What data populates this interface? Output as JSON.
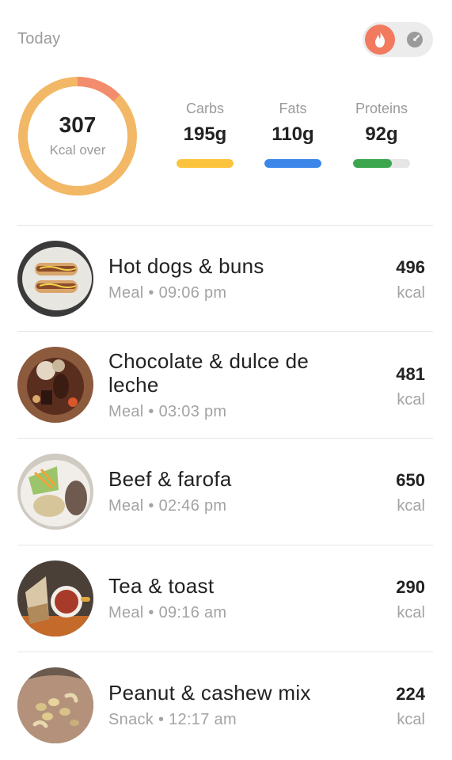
{
  "header": {
    "title": "Today"
  },
  "toggle": {
    "active": "flame-icon",
    "inactive": "gauge-icon",
    "accent": "#f27a5f"
  },
  "summary": {
    "value": "307",
    "label": "Kcal over",
    "ring_color": "#f2b866",
    "over_color": "#f28c6c"
  },
  "macros": [
    {
      "label": "Carbs",
      "value": "195g",
      "color": "#fcc43c",
      "progress": 1.0
    },
    {
      "label": "Fats",
      "value": "110g",
      "color": "#3c86ea",
      "progress": 1.0
    },
    {
      "label": "Proteins",
      "value": "92g",
      "color": "#3ca64e",
      "progress": 0.68
    }
  ],
  "entries": [
    {
      "name": "Hot dogs & buns",
      "type": "Meal",
      "time": "09:06 pm",
      "kcal": "496",
      "unit": "kcal"
    },
    {
      "name": "Chocolate & dulce de leche",
      "type": "Meal",
      "time": "03:03 pm",
      "kcal": "481",
      "unit": "kcal"
    },
    {
      "name": "Beef & farofa",
      "type": "Meal",
      "time": "02:46 pm",
      "kcal": "650",
      "unit": "kcal"
    },
    {
      "name": "Tea & toast",
      "type": "Meal",
      "time": "09:16 am",
      "kcal": "290",
      "unit": "kcal"
    },
    {
      "name": "Peanut & cashew mix",
      "type": "Snack",
      "time": "12:17 am",
      "kcal": "224",
      "unit": "kcal"
    }
  ]
}
